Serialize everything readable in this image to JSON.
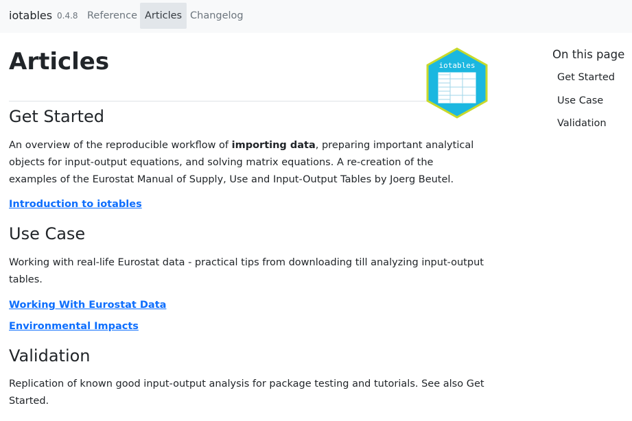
{
  "navbar": {
    "brand": "iotables",
    "version": "0.4.8",
    "links": [
      "Reference",
      "Articles",
      "Changelog"
    ],
    "active_link": "Articles"
  },
  "page": {
    "title": "Articles",
    "logo_text": "iotables"
  },
  "sections": [
    {
      "title": "Get Started",
      "description_parts": [
        "An overview of the reproducible workflow of ",
        "importing data",
        ", preparing important analytical objects for input-output equations, and solving matrix equations. A re-creation of the examples of the Eurostat Manual of Supply, Use and Input-Output Tables by Joerg Beutel."
      ],
      "links": [
        "Introduction to iotables"
      ]
    },
    {
      "title": "Use Case",
      "description": "Working with real-life Eurostat data - practical tips from downloading till analyzing input-output tables.",
      "links": [
        "Working With Eurostat Data",
        "Environmental Impacts"
      ]
    },
    {
      "title": "Validation",
      "description": "Replication of known good input-output analysis for package testing and tutorials. See also Get Started."
    }
  ],
  "toc": {
    "title": "On this page",
    "items": [
      "Get Started",
      "Use Case",
      "Validation"
    ]
  },
  "colors": {
    "link": "#0d6efd",
    "logo_fill": "#1bb7e0",
    "logo_border": "#c8d92b",
    "navbar_bg": "#f8f9fa"
  }
}
